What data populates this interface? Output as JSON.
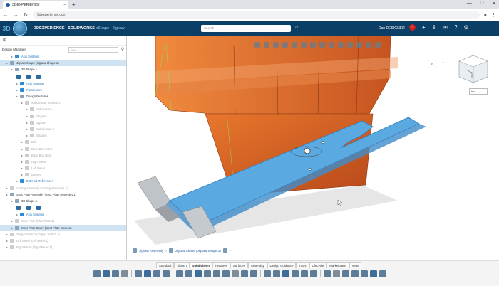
{
  "browser": {
    "tab_title": "3DEXPERIENCE",
    "tab_close": "×",
    "new_tab": "+",
    "url": "3dexperience.com",
    "window_controls": [
      "—",
      "□",
      "✕"
    ]
  },
  "app_bar": {
    "brand": "3DEXPERIENCE",
    "product": "SOLIDWORKS",
    "role": "xShape - Jigsaw",
    "search_placeholder": "Search",
    "user_name": "Dan DESIGNER",
    "notification_count": "3"
  },
  "left_panel": {
    "title": "Design Manager",
    "filter_placeholder": "Find...",
    "tree": [
      {
        "label": "Axis Systems",
        "indent": 2,
        "style": "blue"
      },
      {
        "label": "Jigsaw Shape (Jigsaw Shape.1)",
        "indent": 1,
        "style": "sel"
      },
      {
        "label": "3D Shape.1",
        "indent": 2,
        "style": ""
      },
      {
        "label": "",
        "indent": 3,
        "style": "icons"
      },
      {
        "label": "Axis Systems",
        "indent": 3,
        "style": "blue"
      },
      {
        "label": "Parameters",
        "indent": 3,
        "style": "blue"
      },
      {
        "label": "Design Features",
        "indent": 3,
        "style": ""
      },
      {
        "label": "Subdivision Surface.1",
        "indent": 4,
        "style": "dim"
      },
      {
        "label": "Subdivision.1",
        "indent": 5,
        "style": "dim"
      },
      {
        "label": "Shaped",
        "indent": 5,
        "style": "dim"
      },
      {
        "label": "Jigsaw",
        "indent": 5,
        "style": "dim"
      },
      {
        "label": "Subdivision.2",
        "indent": 5,
        "style": "dim"
      },
      {
        "label": "Shaped",
        "indent": 5,
        "style": "dim"
      },
      {
        "label": "Bolt",
        "indent": 4,
        "style": "dim"
      },
      {
        "label": "Base Box Front",
        "indent": 4,
        "style": "dim"
      },
      {
        "label": "Base Box Back",
        "indent": 4,
        "style": "dim"
      },
      {
        "label": "Right Bezel",
        "indent": 4,
        "style": "dim"
      },
      {
        "label": "Left Bezel",
        "indent": 4,
        "style": "dim"
      },
      {
        "label": "Battery",
        "indent": 4,
        "style": "dim"
      },
      {
        "label": "External References",
        "indent": 3,
        "style": "blue"
      },
      {
        "label": "Cutting Assembly (Cutting Assembly.1)",
        "indent": 1,
        "style": "dim"
      },
      {
        "label": "Shot Plate Assembly (Shot Plate Assembly.1)",
        "indent": 1,
        "style": ""
      },
      {
        "label": "3D Shape.1",
        "indent": 2,
        "style": ""
      },
      {
        "label": "",
        "indent": 3,
        "style": "icons"
      },
      {
        "label": "Axis Systems",
        "indent": 3,
        "style": "blue"
      },
      {
        "label": "Shot Plate (Shot Plate.1)",
        "indent": 2,
        "style": "dim"
      },
      {
        "label": "Shot Plate Cover (Shot Plate Cover.1)",
        "indent": 2,
        "style": "sel"
      },
      {
        "label": "Trigger Switch (Trigger Switch.1)",
        "indent": 1,
        "style": "dim"
      },
      {
        "label": "Left Bezel (Left Bezel.1)",
        "indent": 1,
        "style": "dim"
      },
      {
        "label": "Right Bezel (Right Bezel.1)",
        "indent": 1,
        "style": "dim"
      }
    ]
  },
  "viewport": {
    "breadcrumb_root": "Jigsaw Assembly",
    "breadcrumb_current": "Jigsaw Shape (Jigsaw Shape.1)",
    "view_select": "Iso"
  },
  "action_bar": {
    "sections": [
      "Standard",
      "Sketch",
      "Subdivision",
      "Features",
      "Surfaces",
      "Assembly",
      "Design Guidance",
      "Tools",
      "Lifecycle",
      "Marketplace",
      "View"
    ],
    "active_section": "Subdivision"
  },
  "colors": {
    "app_bar": "#0b3f66",
    "model_orange": "#d8601f",
    "plate_blue": "#5aa9e0",
    "selection": "#cfe3f3"
  }
}
